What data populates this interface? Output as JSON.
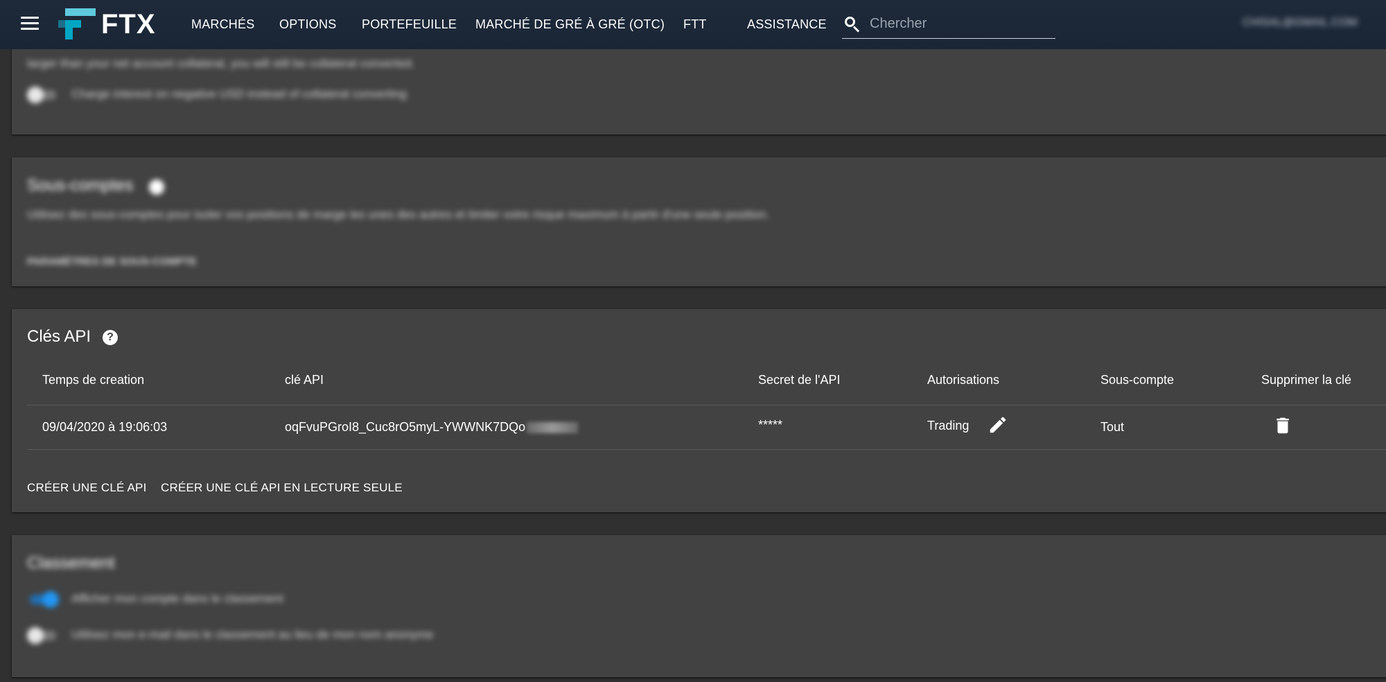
{
  "header": {
    "logo_text": "FTX",
    "nav": [
      {
        "label": "MARCHÉS"
      },
      {
        "label": "OPTIONS"
      },
      {
        "label": "PORTEFEUILLE"
      },
      {
        "label": "MARCHÉ DE GRÉ À GRÉ (OTC)"
      },
      {
        "label": "FTT"
      },
      {
        "label": "ASSISTANCE"
      }
    ],
    "search_placeholder": "Chercher",
    "user_email": "CHISAL@GMAIL.COM"
  },
  "collateral": {
    "line1": "larger than your net account collateral, you will still be collateral converted.",
    "toggle_label": "Charge interest on negative USD instead of collateral converting"
  },
  "subaccounts": {
    "title": "Sous-comptes",
    "description": "Utilisez des sous-comptes pour isoler vos positions de marge les unes des autres et limiter votre risque maximum à partir d'une seule position.",
    "button": "PARAMÈTRES DE SOUS-COMPTE"
  },
  "api_keys": {
    "title": "Clés API",
    "columns": [
      "Temps de creation",
      "clé API",
      "Secret de l'API",
      "Autorisations",
      "Sous-compte",
      "Supprimer la clé"
    ],
    "rows": [
      {
        "created": "09/04/2020 à 19:06:03",
        "key": "oqFvuPGroI8_Cuc8rO5myL-YWWNK7DQo",
        "secret": "*****",
        "permissions": "Trading",
        "subaccount": "Tout"
      }
    ],
    "create_button": "CRÉER UNE CLÉ API",
    "create_readonly_button": "CRÉER UNE CLÉ API EN LECTURE SEULE"
  },
  "leaderboard": {
    "title": "Classement",
    "toggle1_label": "Afficher mon compte dans le classement",
    "toggle1_on": true,
    "toggle2_label": "Utilisez mon e-mail dans le classement au lieu de mon nom anonyme",
    "toggle2_on": false
  }
}
